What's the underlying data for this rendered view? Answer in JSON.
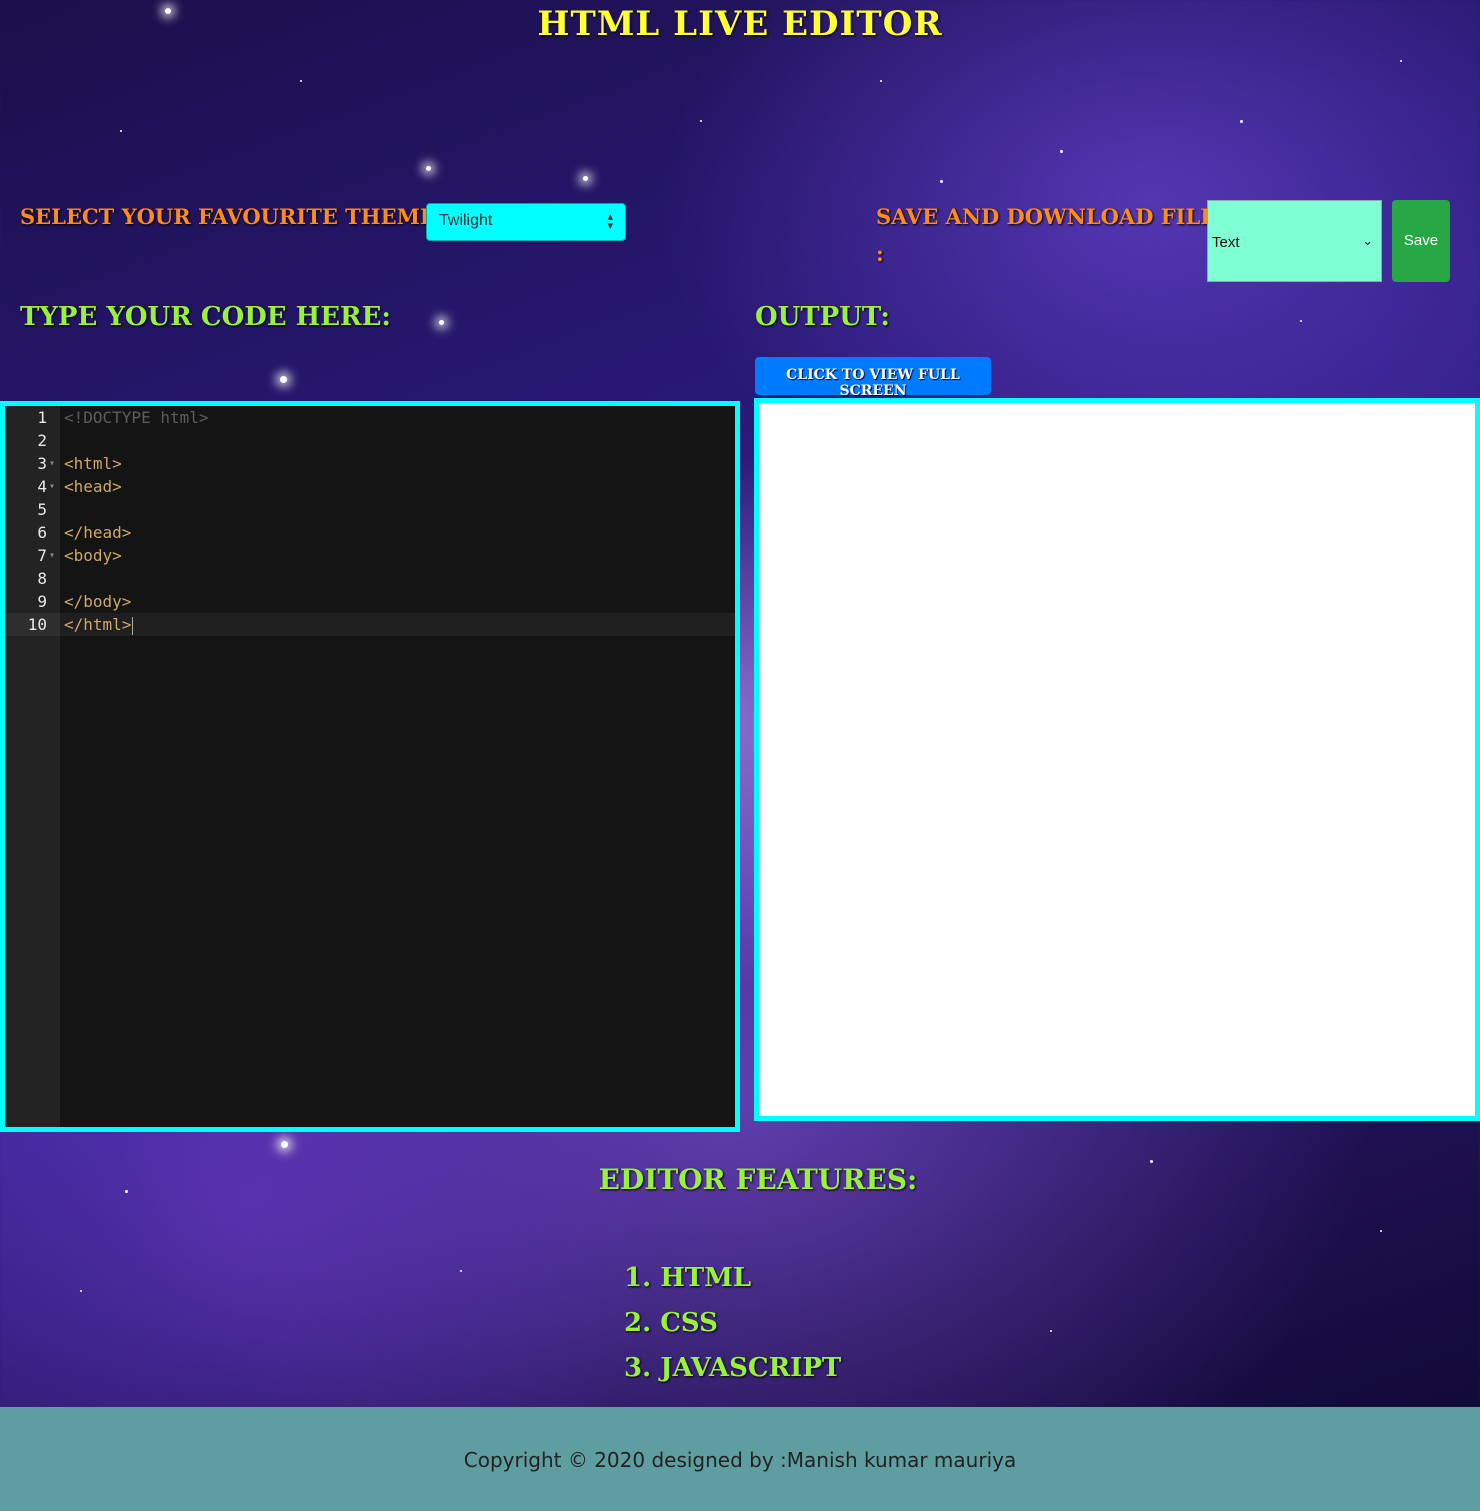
{
  "header": {
    "title": "HTML LIVE EDITOR"
  },
  "theme": {
    "label": "SELECT YOUR FAVOURITE THEMES:",
    "selected": "Twilight"
  },
  "save": {
    "label": "SAVE AND DOWNLOAD FILES",
    "colon": ":",
    "file_type": "Text",
    "button_label": "Save"
  },
  "editor": {
    "label": "TYPE YOUR CODE HERE:",
    "lines": [
      {
        "num": "1",
        "text": "<!DOCTYPE html>"
      },
      {
        "num": "2",
        "text": ""
      },
      {
        "num": "3",
        "text": "<html>"
      },
      {
        "num": "4",
        "text": "<head>"
      },
      {
        "num": "5",
        "text": ""
      },
      {
        "num": "6",
        "text": "</head>"
      },
      {
        "num": "7",
        "text": "<body>"
      },
      {
        "num": "8",
        "text": ""
      },
      {
        "num": "9",
        "text": "</body>"
      },
      {
        "num": "10",
        "text": "</html>"
      }
    ],
    "theme_colors": {
      "background": "#141414",
      "gutter": "#232323",
      "tag": "#cda869",
      "doctype": "#5f5a60"
    }
  },
  "output": {
    "label": "OUTPUT:",
    "fullscreen_button": "CLICK TO VIEW FULL SCREEN"
  },
  "features": {
    "title": "EDITOR FEATURES:",
    "items": [
      "1. HTML",
      "2. CSS",
      "3. JAVASCRIPT"
    ]
  },
  "footer": {
    "text": "Copyright © 2020 designed by :Manish kumar mauriya"
  },
  "colors": {
    "title": "#ffff33",
    "orange_label": "#ff8c1a",
    "green_label": "#9af13b",
    "border": "#00ffff",
    "footer_bg": "#5f9ea0"
  }
}
